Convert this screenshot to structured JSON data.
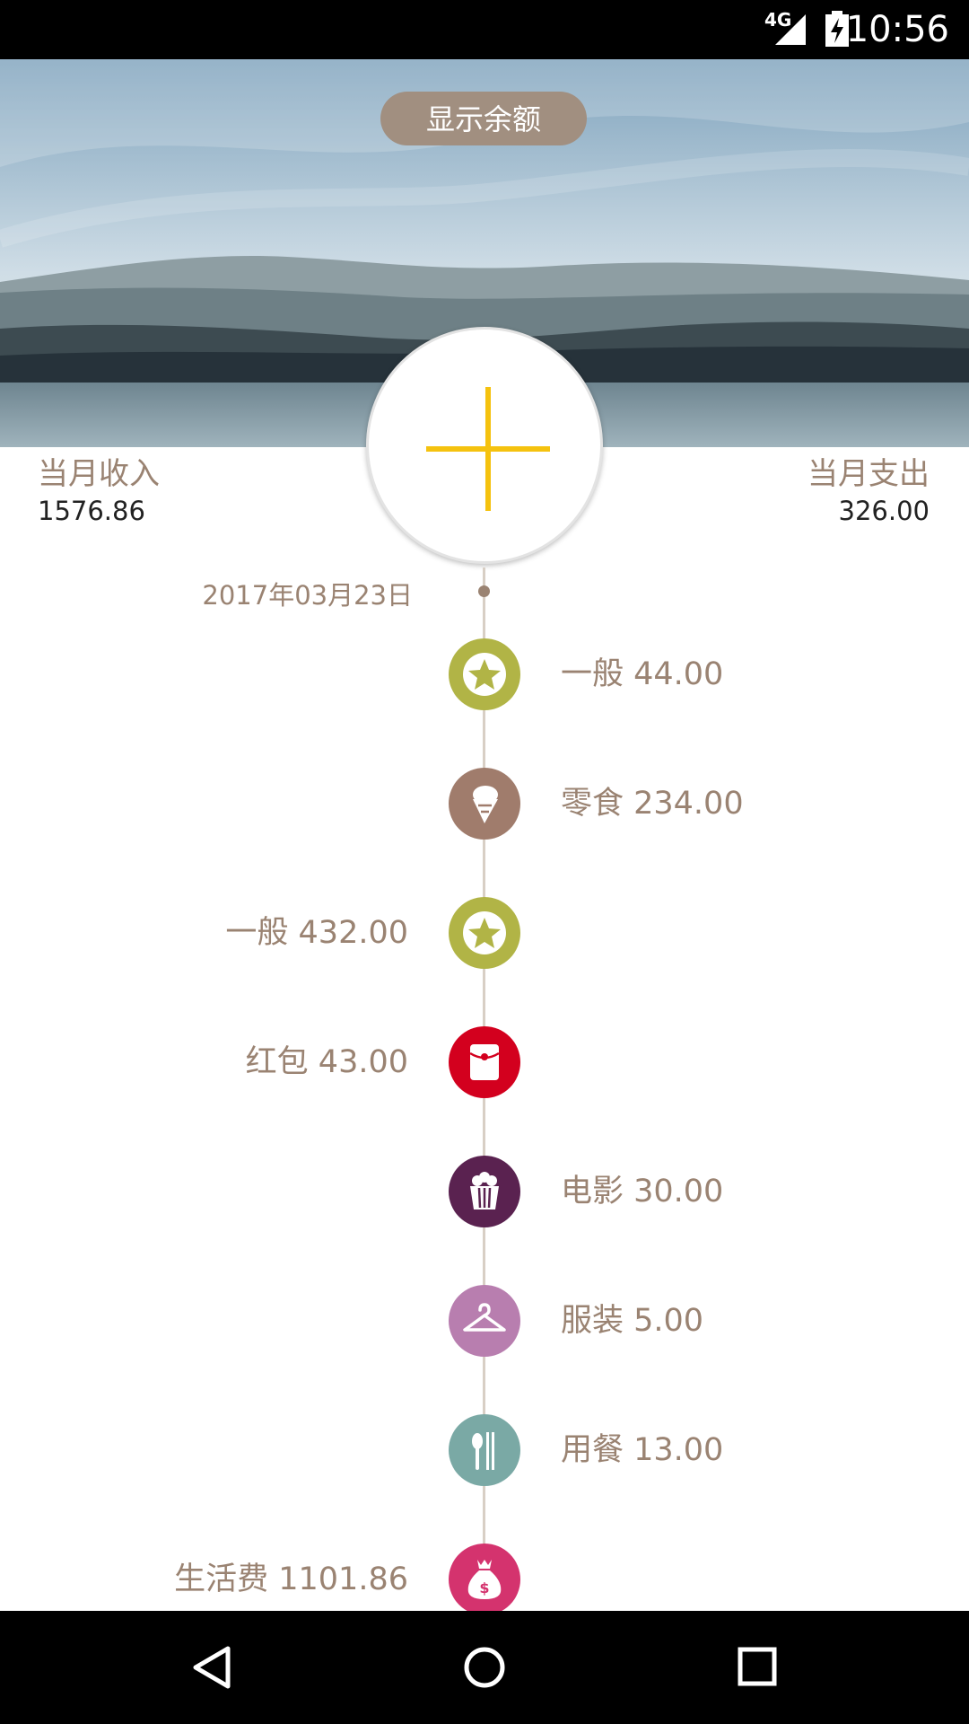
{
  "status_bar": {
    "network": "4G",
    "time": "10:56"
  },
  "header": {
    "show_balance_label": "显示余额"
  },
  "summary": {
    "income_label": "当月收入",
    "income_value": "1576.86",
    "expense_label": "当月支出",
    "expense_value": "326.00"
  },
  "timeline": {
    "date": "2017年03月23日",
    "entries": [
      {
        "text": "一般 44.00",
        "side": "right",
        "icon": "star-icon",
        "color": "#b1b446"
      },
      {
        "text": "零食 234.00",
        "side": "right",
        "icon": "ice-cream-icon",
        "color": "#a07c6c"
      },
      {
        "text": "一般 432.00",
        "side": "left",
        "icon": "star-icon",
        "color": "#b1b446"
      },
      {
        "text": "红包 43.00",
        "side": "left",
        "icon": "red-envelope-icon",
        "color": "#d3001e"
      },
      {
        "text": "电影 30.00",
        "side": "right",
        "icon": "popcorn-icon",
        "color": "#5a2250"
      },
      {
        "text": "服装 5.00",
        "side": "right",
        "icon": "hanger-icon",
        "color": "#b87eaf"
      },
      {
        "text": "用餐 13.00",
        "side": "right",
        "icon": "utensils-icon",
        "color": "#7aa9a5"
      },
      {
        "text": "生活费 1101.86",
        "side": "left",
        "icon": "money-bag-icon",
        "color": "#d4336e"
      }
    ]
  },
  "colors": {
    "accent_text": "#9a8372",
    "plus": "#f5c20f",
    "button_bg": "#a18f80"
  }
}
